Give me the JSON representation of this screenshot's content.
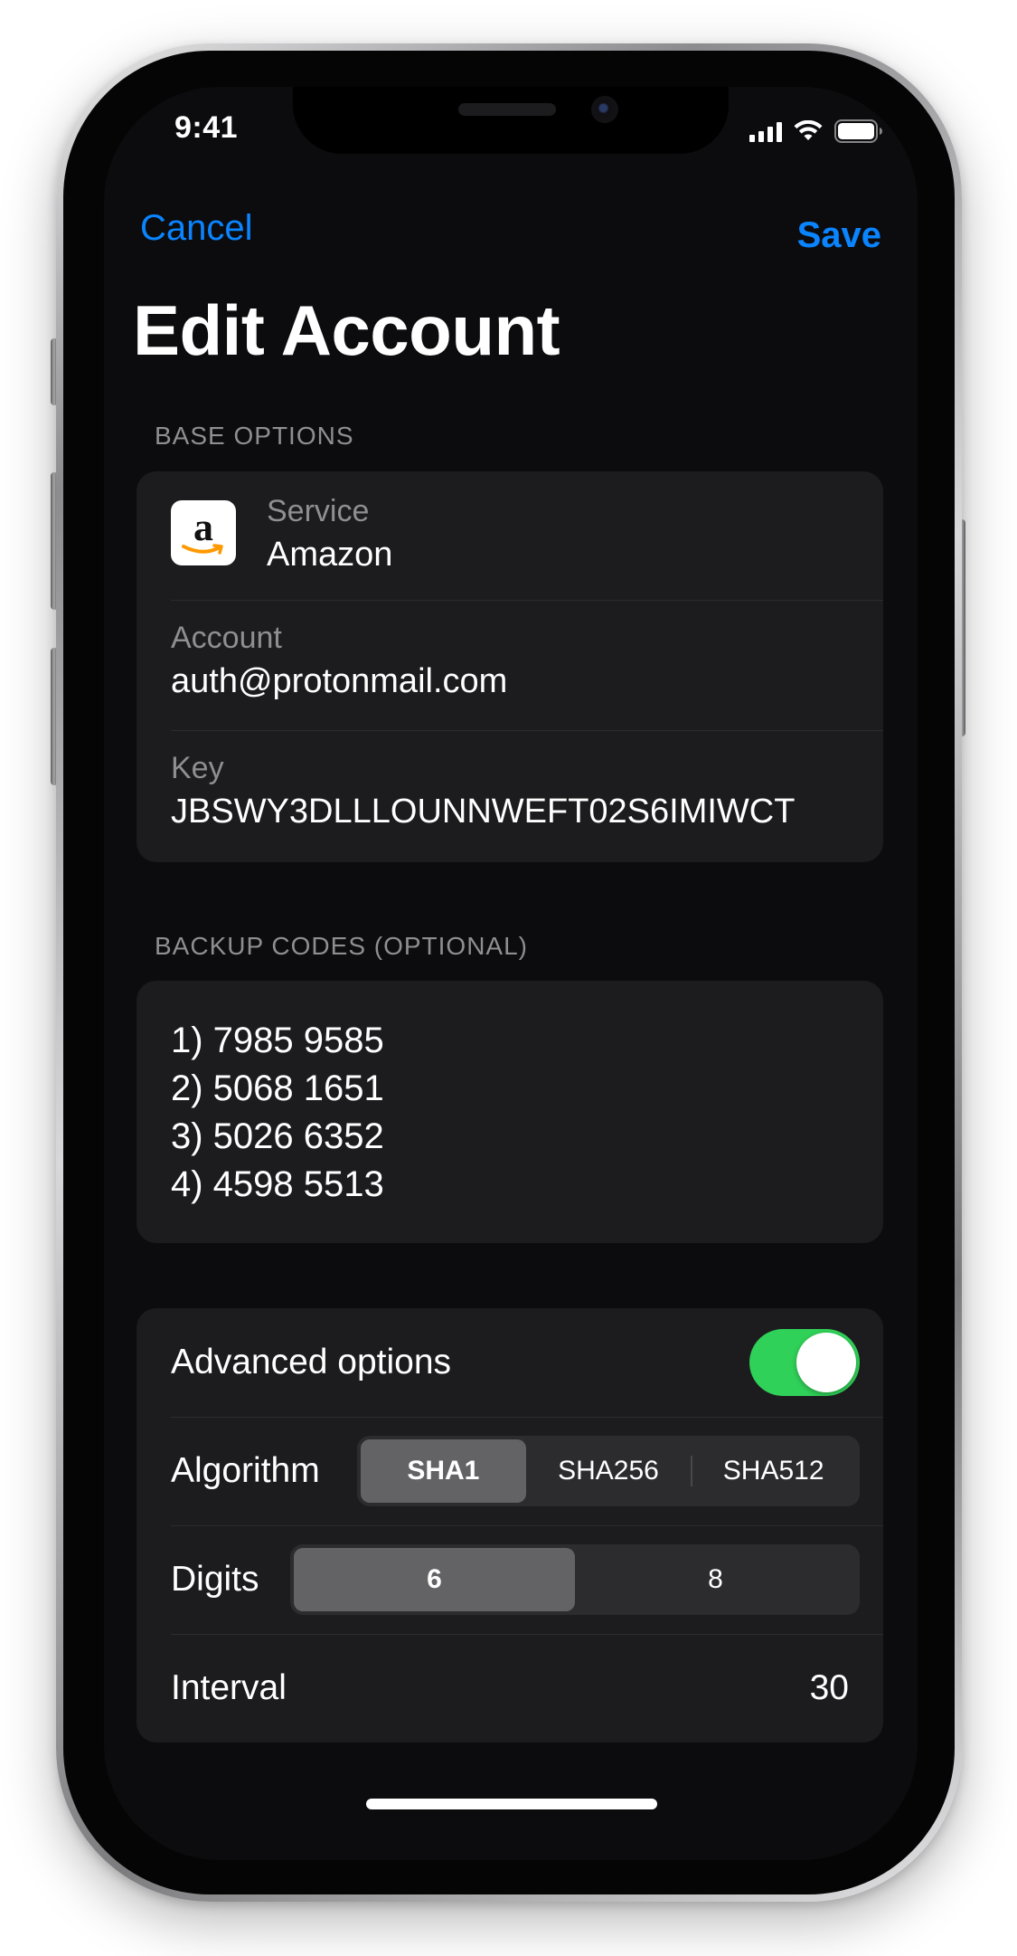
{
  "status_bar": {
    "time": "9:41",
    "signal_icon": "cellular-signal-icon",
    "wifi_icon": "wifi-icon",
    "battery_icon": "battery-full-icon"
  },
  "nav": {
    "cancel_label": "Cancel",
    "save_label": "Save",
    "title": "Edit Account"
  },
  "base_options": {
    "header": "BASE OPTIONS",
    "service_label": "Service",
    "service_value": "Amazon",
    "service_logo_letter": "a",
    "account_label": "Account",
    "account_value": "auth@protonmail.com",
    "key_label": "Key",
    "key_value": "JBSWY3DLLLOUNNWEFT02S6IMIWCT"
  },
  "backup_codes": {
    "header": "BACKUP CODES (OPTIONAL)",
    "codes": [
      "1) 7985 9585",
      "2) 5068 1651",
      "3) 5026 6352",
      "4) 4598 5513"
    ]
  },
  "advanced": {
    "toggle_label": "Advanced options",
    "toggle_on": true,
    "algorithm_label": "Algorithm",
    "algorithm_options": [
      "SHA1",
      "SHA256",
      "SHA512"
    ],
    "algorithm_selected": "SHA1",
    "digits_label": "Digits",
    "digits_options": [
      "6",
      "8"
    ],
    "digits_selected": "6",
    "interval_label": "Interval",
    "interval_value": "30"
  },
  "colors": {
    "accent": "#0a84ff",
    "toggle_on": "#30d158",
    "background": "#0c0c0e",
    "card": "#1c1c1e",
    "secondary_text": "#8e8e93"
  }
}
